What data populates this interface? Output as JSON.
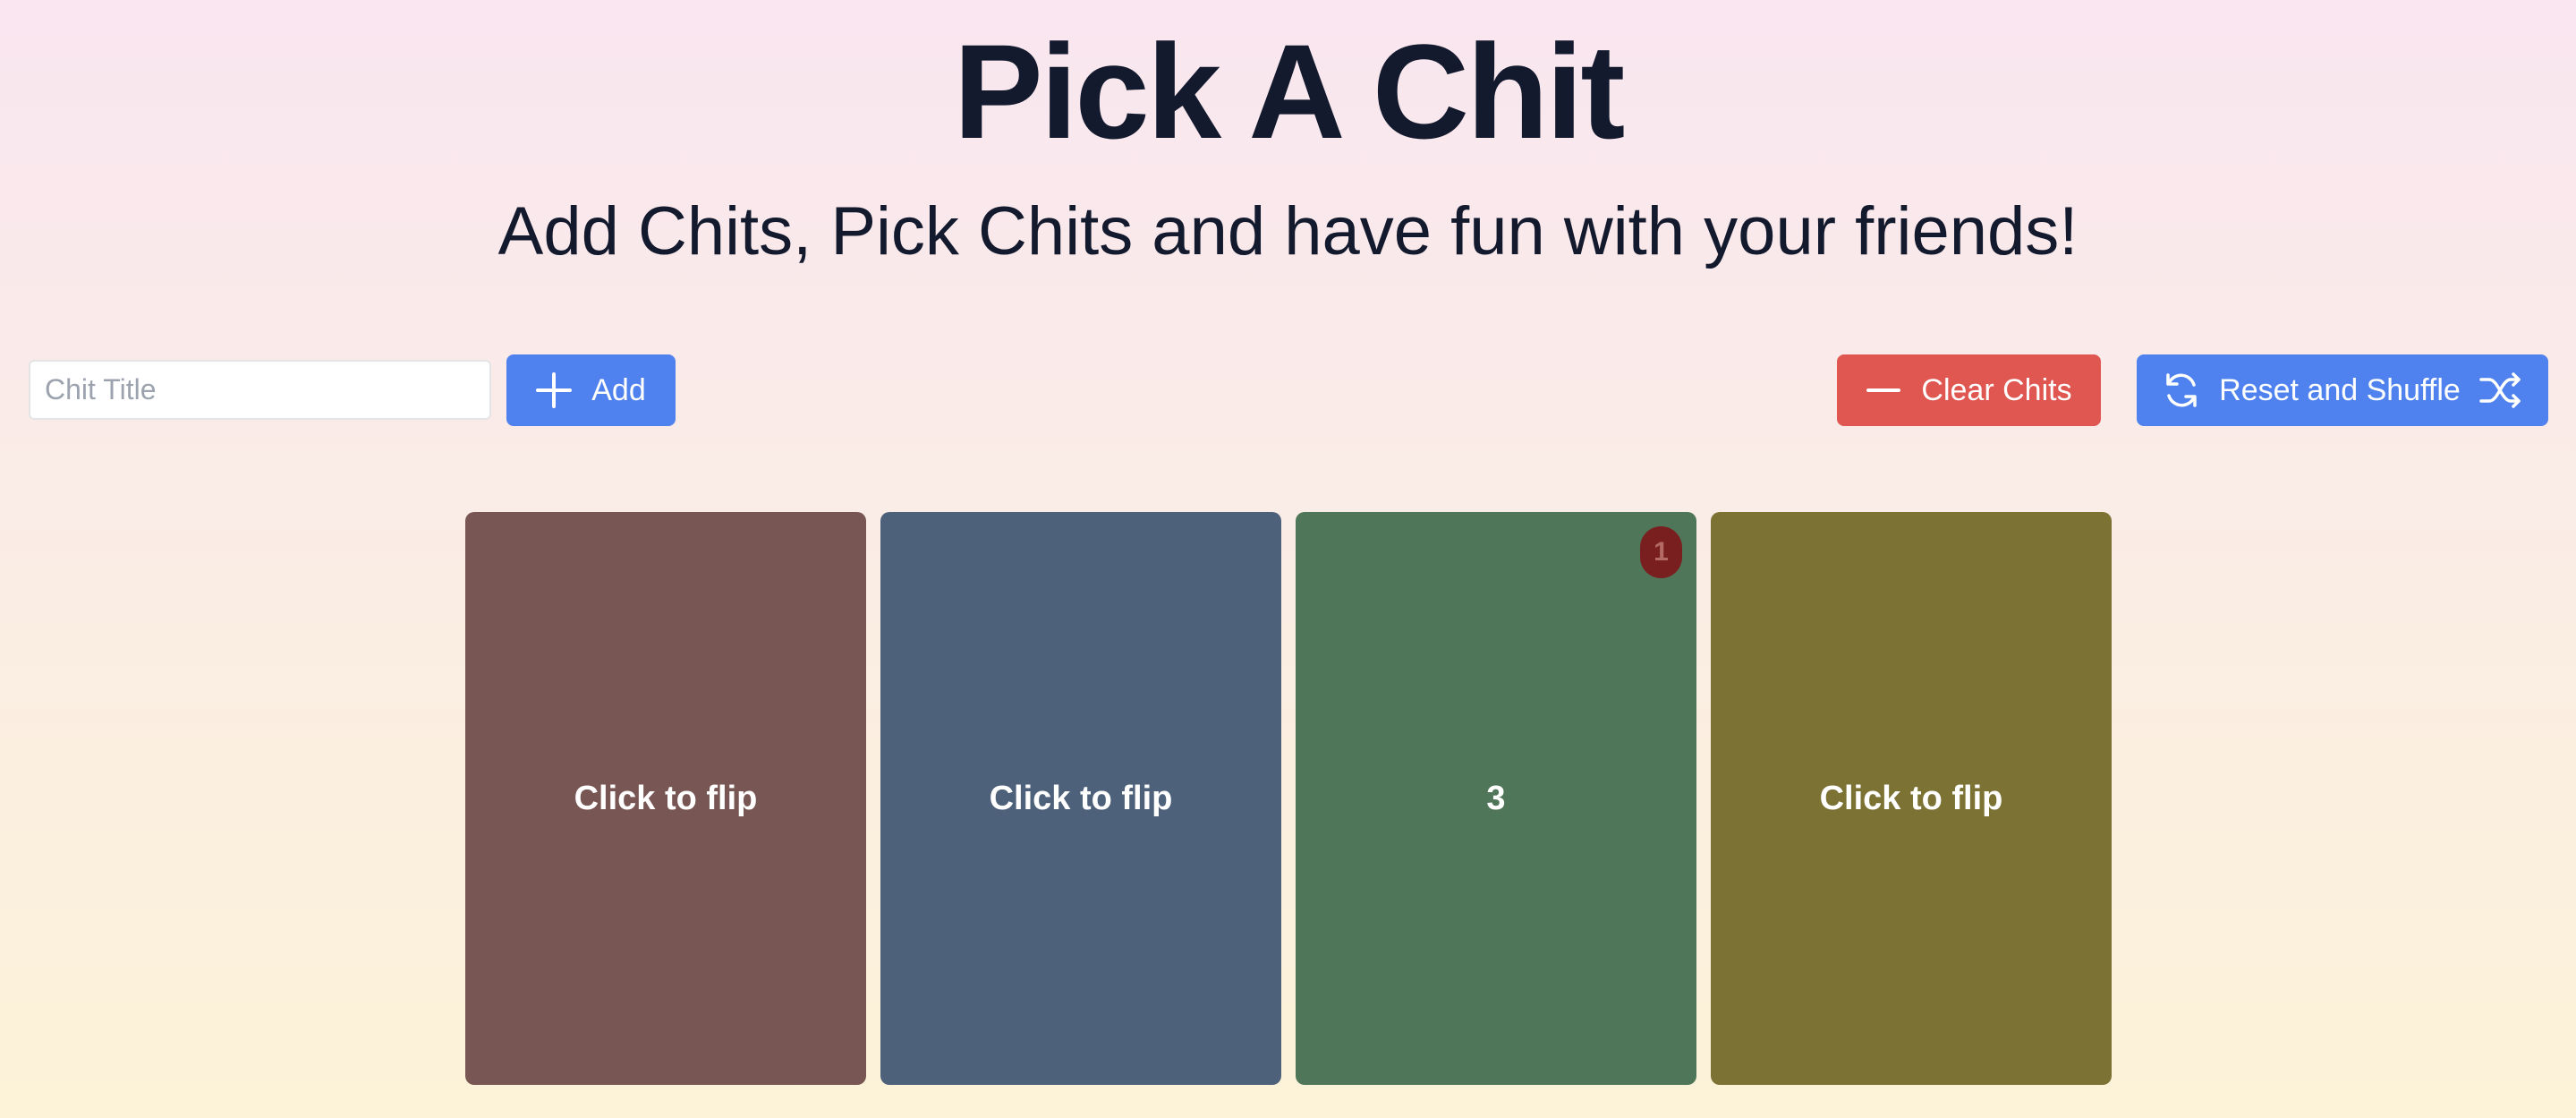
{
  "header": {
    "title": "Pick A Chit",
    "subtitle": "Add Chits, Pick Chits and have fun with your friends!"
  },
  "controls": {
    "input_placeholder": "Chit Title",
    "input_value": "",
    "add_label": "Add",
    "add_icon": "plus-icon",
    "clear_label": "Clear Chits",
    "clear_icon": "minus-icon",
    "reset_label": "Reset and Shuffle",
    "reset_icon": "refresh-icon",
    "shuffle_icon": "shuffle-icon"
  },
  "colors": {
    "primary_button": "#4f82ee",
    "danger_button": "#e05650",
    "title_text": "#131a2e"
  },
  "cards": [
    {
      "label": "Click to flip",
      "color": "#785653",
      "flipped": false,
      "badge": ""
    },
    {
      "label": "Click to flip",
      "color": "#4e617a",
      "flipped": false,
      "badge": ""
    },
    {
      "label": "3",
      "color": "#4f7659",
      "flipped": true,
      "badge": "1"
    },
    {
      "label": "Click to flip",
      "color": "#7c7234",
      "flipped": false,
      "badge": ""
    }
  ]
}
